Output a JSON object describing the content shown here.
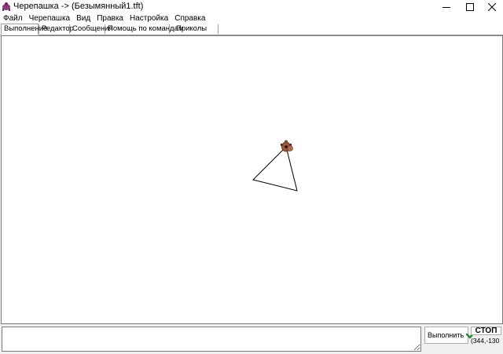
{
  "window": {
    "title": "Черепашка -> (Безымянный1.tft)",
    "app_icon": "turtle-icon",
    "controls": [
      "minimize-icon",
      "maximize-icon",
      "close-icon"
    ]
  },
  "menu": {
    "items": [
      "Файл",
      "Черепашка",
      "Вид",
      "Правка",
      "Настройка",
      "Справка"
    ]
  },
  "tabs": {
    "items": [
      "Выполнение",
      "Редактор",
      "Сообщения",
      "Помощь по командам",
      "Приколы"
    ],
    "active": "Выполнение"
  },
  "canvas": {
    "shape": "triangle",
    "turtle_icon": "turtle-icon",
    "line_color": "#000000",
    "turtle_color": "#9a5a3a"
  },
  "command": {
    "input_value": "",
    "run_label": "Выполнить",
    "run_icon": "checkmark-icon",
    "stop_label": "СТОП",
    "coordinates": "(344,-130"
  }
}
